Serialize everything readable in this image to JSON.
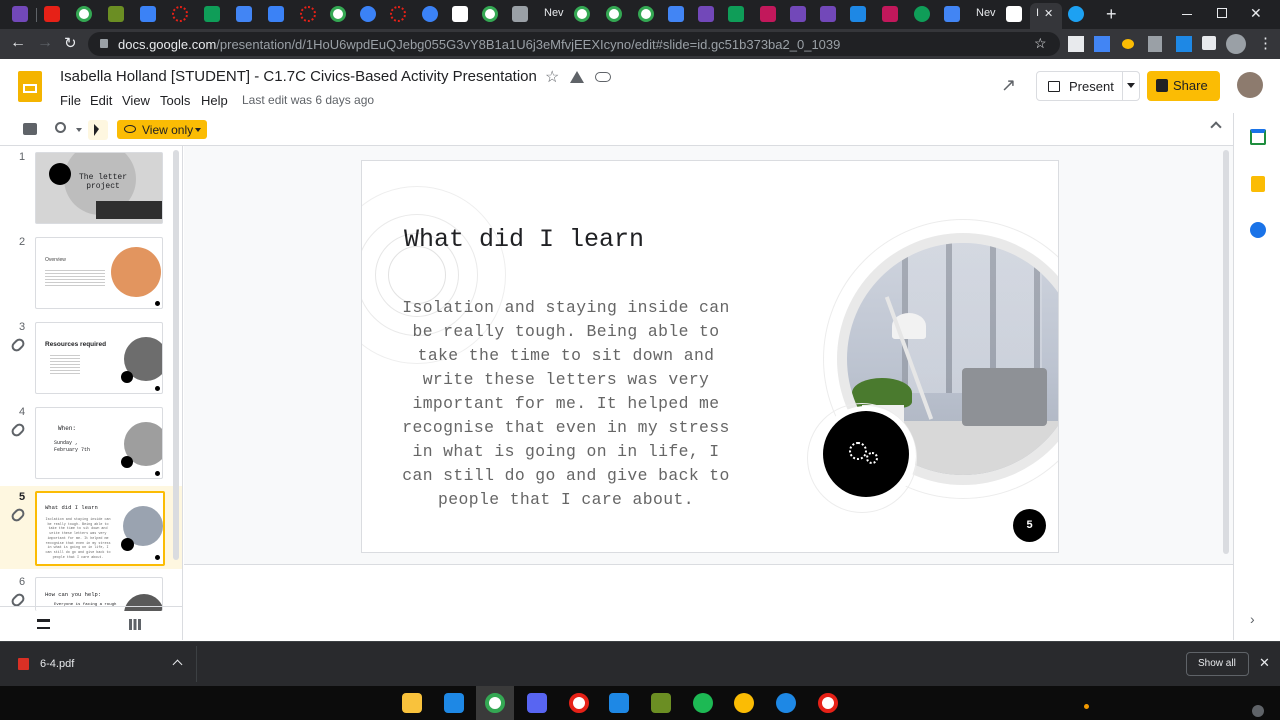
{
  "browser": {
    "tabs": [
      {
        "label": "Nev"
      },
      {
        "label": "Nev"
      },
      {
        "label": "I"
      }
    ],
    "new_tab": "+",
    "close_tab": "✕",
    "url_host": "docs.google.com",
    "url_path": "/presentation/d/1HoU6wpdEuQJebg055G3vY8B1a1U6j3eMfvjEEXIcyno/edit#slide=id.gc51b373ba2_0_1039"
  },
  "doc": {
    "title": "Isabella Holland [STUDENT] - C1.7C Civics-Based Activity Presentation",
    "menus": [
      "File",
      "Edit",
      "View",
      "Tools",
      "Help"
    ],
    "last_edit": "Last edit was 6 days ago",
    "present_label": "Present",
    "share_label": "Share",
    "view_only_label": "View only"
  },
  "filmstrip": {
    "slides": [
      {
        "num": "1",
        "title": "The letter project"
      },
      {
        "num": "2",
        "title": "Overview"
      },
      {
        "num": "3",
        "title": "Resources required"
      },
      {
        "num": "4",
        "title": "When:",
        "sub": "Sunday , February 7th"
      },
      {
        "num": "5",
        "title": "What did I learn"
      },
      {
        "num": "6",
        "title": "How can you help:",
        "sub": "Everyone is facing a rough"
      }
    ],
    "selected": "5"
  },
  "slide": {
    "title": "What did I learn",
    "body": "Isolation and staying inside can be really tough. Being able to take the time to sit down and write these letters was very important for me. It helped me recognise that even in my stress in what is going on in life, I can still do go and give back to people that I care about.",
    "page_number": "5"
  },
  "downloads": {
    "file_name": "6-4.pdf",
    "show_all": "Show all"
  },
  "colors": {
    "accent": "#fbbc04",
    "tab_bg": "#202124",
    "chrome_bg": "#35363a",
    "download_bg": "#292a2d"
  }
}
